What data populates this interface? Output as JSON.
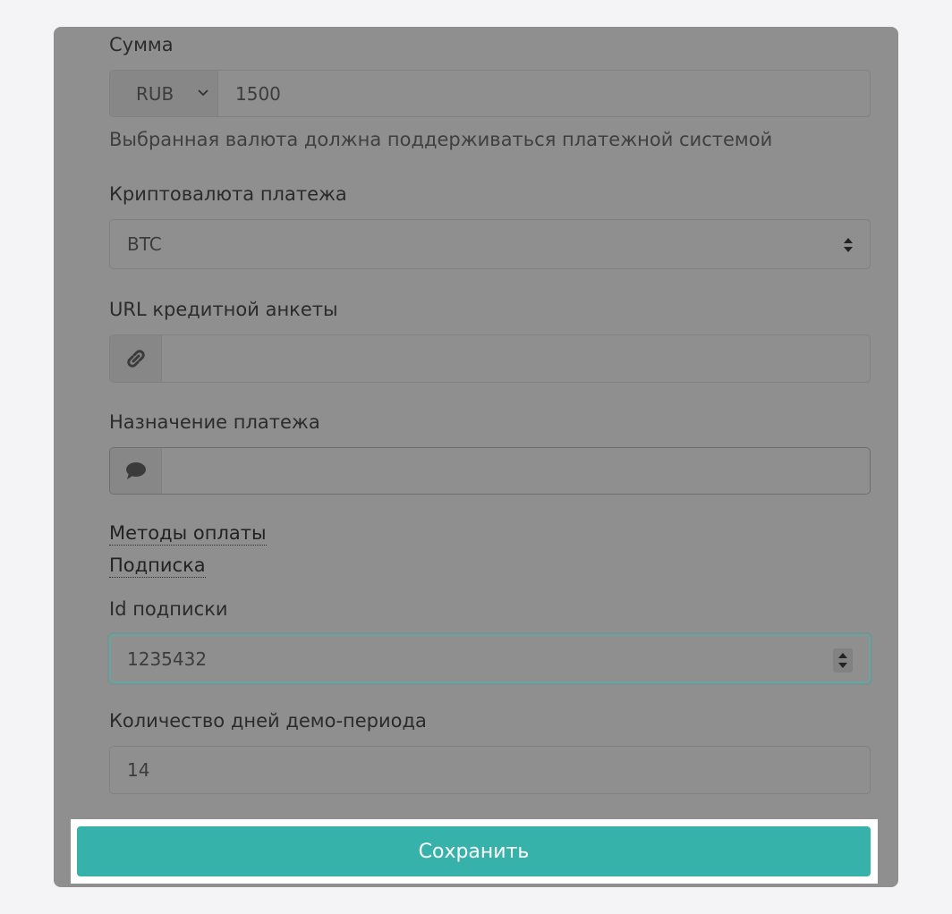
{
  "form": {
    "amount": {
      "label": "Сумма",
      "currency": "RUB",
      "value": "1500",
      "help": "Выбранная валюта должна поддерживаться платежной системой"
    },
    "crypto": {
      "label": "Криптовалюта платежа",
      "value": "BTC"
    },
    "credit_url": {
      "label": "URL кредитной анкеты",
      "value": "",
      "icon": "link-icon"
    },
    "purpose": {
      "label": "Назначение платежа",
      "value": "",
      "icon": "comment-icon"
    },
    "links": {
      "payment_methods": "Методы оплаты",
      "subscription": "Подписка"
    },
    "subscription_id": {
      "label": "Id подписки",
      "value": "1235432"
    },
    "demo_days": {
      "label": "Количество дней демо-периода",
      "value": "14"
    },
    "save_label": "Сохранить"
  },
  "colors": {
    "page_background": "#f4f4f6",
    "overlay": "#8f8f8f",
    "accent": "#37b2aa",
    "focus_border": "#6aa3a0"
  }
}
